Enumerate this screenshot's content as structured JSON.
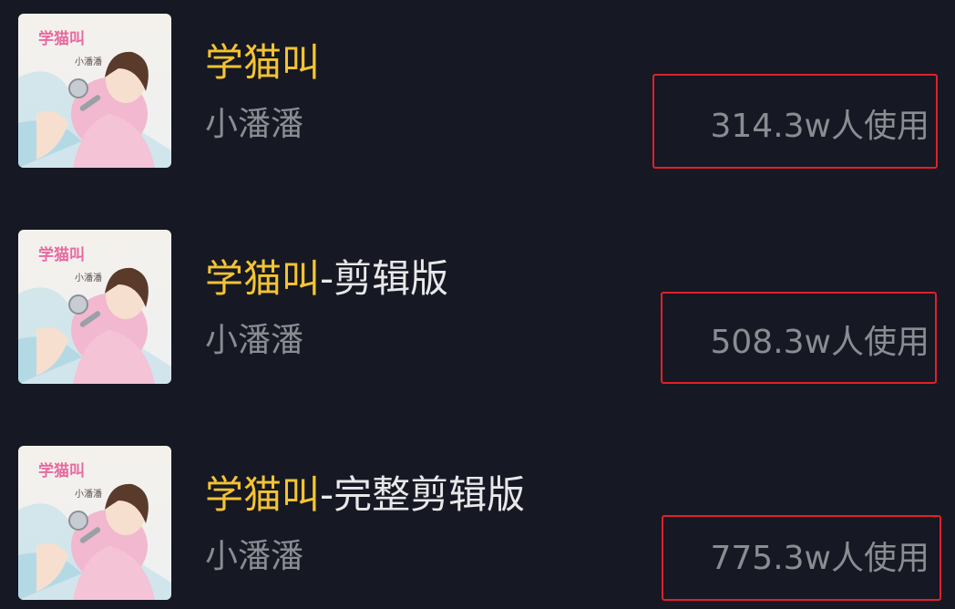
{
  "songs": [
    {
      "cover_title": "学猫叫",
      "cover_artist": "小潘潘",
      "title": "学猫叫",
      "title_suffix": "",
      "artist": "小潘潘",
      "usage": "314.3w人使用"
    },
    {
      "cover_title": "学猫叫",
      "cover_artist": "小潘潘",
      "title": "学猫叫",
      "title_suffix": "-剪辑版",
      "artist": "小潘潘",
      "usage": "508.3w人使用"
    },
    {
      "cover_title": "学猫叫",
      "cover_artist": "小潘潘",
      "title": "学猫叫",
      "title_suffix": "-完整剪辑版",
      "artist": "小潘潘",
      "usage": "775.3w人使用"
    }
  ],
  "colors": {
    "background": "#161823",
    "title": "#f3c332",
    "title_suffix": "#e8e8ea",
    "secondary_text": "#8b8c92",
    "highlight_box": "#e0212b"
  },
  "icons": {
    "cover": "album-cover-illustration-girl-with-shower-head"
  }
}
